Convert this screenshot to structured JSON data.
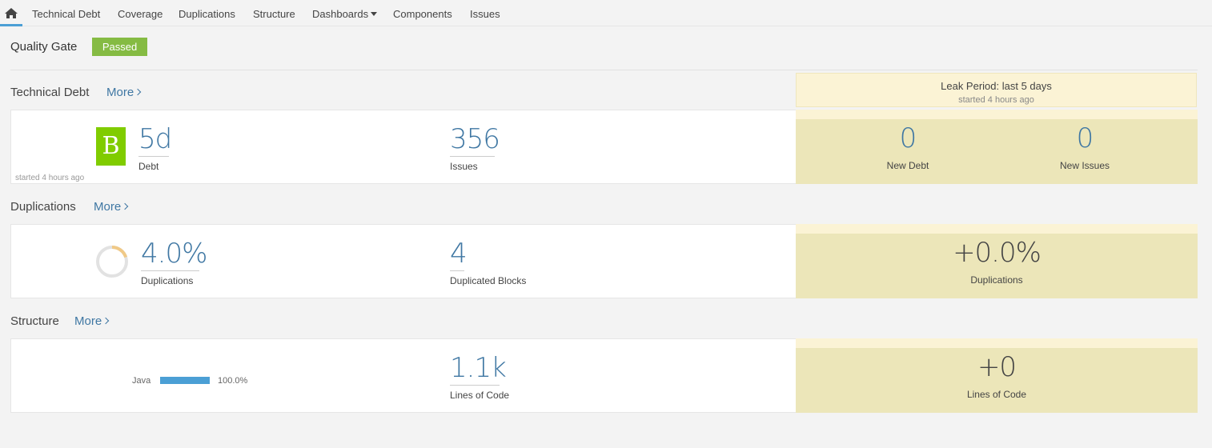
{
  "nav": {
    "items": [
      "Technical Debt",
      "Coverage",
      "Duplications",
      "Structure",
      "Dashboards",
      "Components",
      "Issues"
    ]
  },
  "quality_gate": {
    "label": "Quality Gate",
    "status": "Passed",
    "status_color": "#85bb43"
  },
  "leak_period": {
    "title": "Leak Period: last 5 days",
    "subtitle": "started 4 hours ago"
  },
  "more_label": "More",
  "technical_debt": {
    "title": "Technical Debt",
    "rating": "B",
    "rating_color": "#80cc00",
    "debt_value": "5d",
    "debt_label": "Debt",
    "issues_value": "356",
    "issues_label": "Issues",
    "started_note": "started 4 hours ago",
    "new_debt_value": "0",
    "new_debt_label": "New Debt",
    "new_issues_value": "0",
    "new_issues_label": "New Issues"
  },
  "duplications": {
    "title": "Duplications",
    "density_value": "4.0%",
    "density_fraction": 0.04,
    "density_label": "Duplications",
    "blocks_value": "4",
    "blocks_label": "Duplicated Blocks",
    "new_value": "+0.0%",
    "new_label": "Duplications"
  },
  "structure": {
    "title": "Structure",
    "language": "Java",
    "language_pct": "100.0%",
    "language_fraction": 1.0,
    "loc_value": "1.1k",
    "loc_label": "Lines of Code",
    "new_loc_value": "+0",
    "new_loc_label": "Lines of Code"
  }
}
